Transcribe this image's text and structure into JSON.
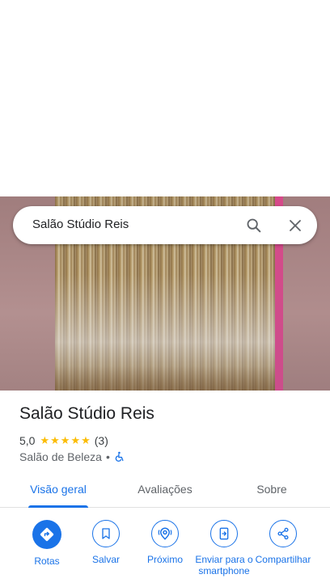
{
  "search": {
    "query": "Salão Stúdio Reis"
  },
  "place": {
    "name": "Salão Stúdio Reis",
    "rating": "5,0",
    "stars": 5,
    "review_count": "(3)",
    "category": "Salão de Beleza",
    "separator": "•",
    "accessibility_icon": "wheelchair-accessible-icon"
  },
  "tabs": [
    {
      "label": "Visão geral",
      "active": true
    },
    {
      "label": "Avaliações",
      "active": false
    },
    {
      "label": "Sobre",
      "active": false
    }
  ],
  "actions": [
    {
      "label": "Rotas",
      "icon": "directions-icon"
    },
    {
      "label": "Salvar",
      "icon": "bookmark-icon"
    },
    {
      "label": "Próximo",
      "icon": "nearby-icon"
    },
    {
      "label": "Enviar para o smartphone",
      "icon": "send-to-phone-icon"
    },
    {
      "label": "Compartilhar",
      "icon": "share-icon"
    }
  ],
  "colors": {
    "accent": "#1a73e8",
    "star": "#fbbc04",
    "text_primary": "#202124",
    "text_secondary": "#5f6368"
  }
}
